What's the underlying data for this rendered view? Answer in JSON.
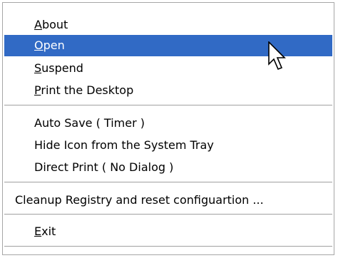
{
  "context_menu": {
    "items": [
      {
        "label": "About",
        "accelerator": "A",
        "rest": "bout"
      },
      {
        "label": "Open",
        "accelerator": "O",
        "rest": "pen",
        "selected": true
      },
      {
        "label": "Suspend",
        "accelerator": "S",
        "rest": "uspend"
      },
      {
        "label": "Print the Desktop",
        "accelerator": "P",
        "rest": "rint the Desktop"
      },
      {
        "label": "Auto Save ( Timer )"
      },
      {
        "label": "Hide Icon from the System Tray"
      },
      {
        "label": "Direct Print ( No Dialog )"
      },
      {
        "label": "Cleanup Registry and reset configuartion ..."
      },
      {
        "label": "Exit",
        "accelerator": "E",
        "rest": "xit"
      }
    ]
  },
  "colors": {
    "selection_background": "#316ac5",
    "selection_text": "#ffffff",
    "border": "#a7a7a7"
  },
  "cursor": {
    "icon": "arrow-pointer-icon"
  }
}
